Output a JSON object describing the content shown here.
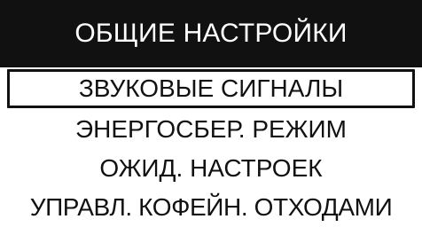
{
  "header": {
    "title": "ОБЩИЕ НАСТРОЙКИ"
  },
  "menu": {
    "items": [
      {
        "label": "ЗВУКОВЫЕ СИГНАЛЫ",
        "selected": true
      },
      {
        "label": "ЭНЕРГОСБЕР. РЕЖИМ",
        "selected": false
      },
      {
        "label": "ОЖИД. НАСТРОЕК",
        "selected": false
      },
      {
        "label": "УПРАВЛ. КОФЕЙН. ОТХОДАМИ",
        "selected": false
      }
    ]
  },
  "colors": {
    "background": "#ffffff",
    "foreground": "#111111",
    "header_background": "#111111",
    "header_text": "#ffffff"
  }
}
